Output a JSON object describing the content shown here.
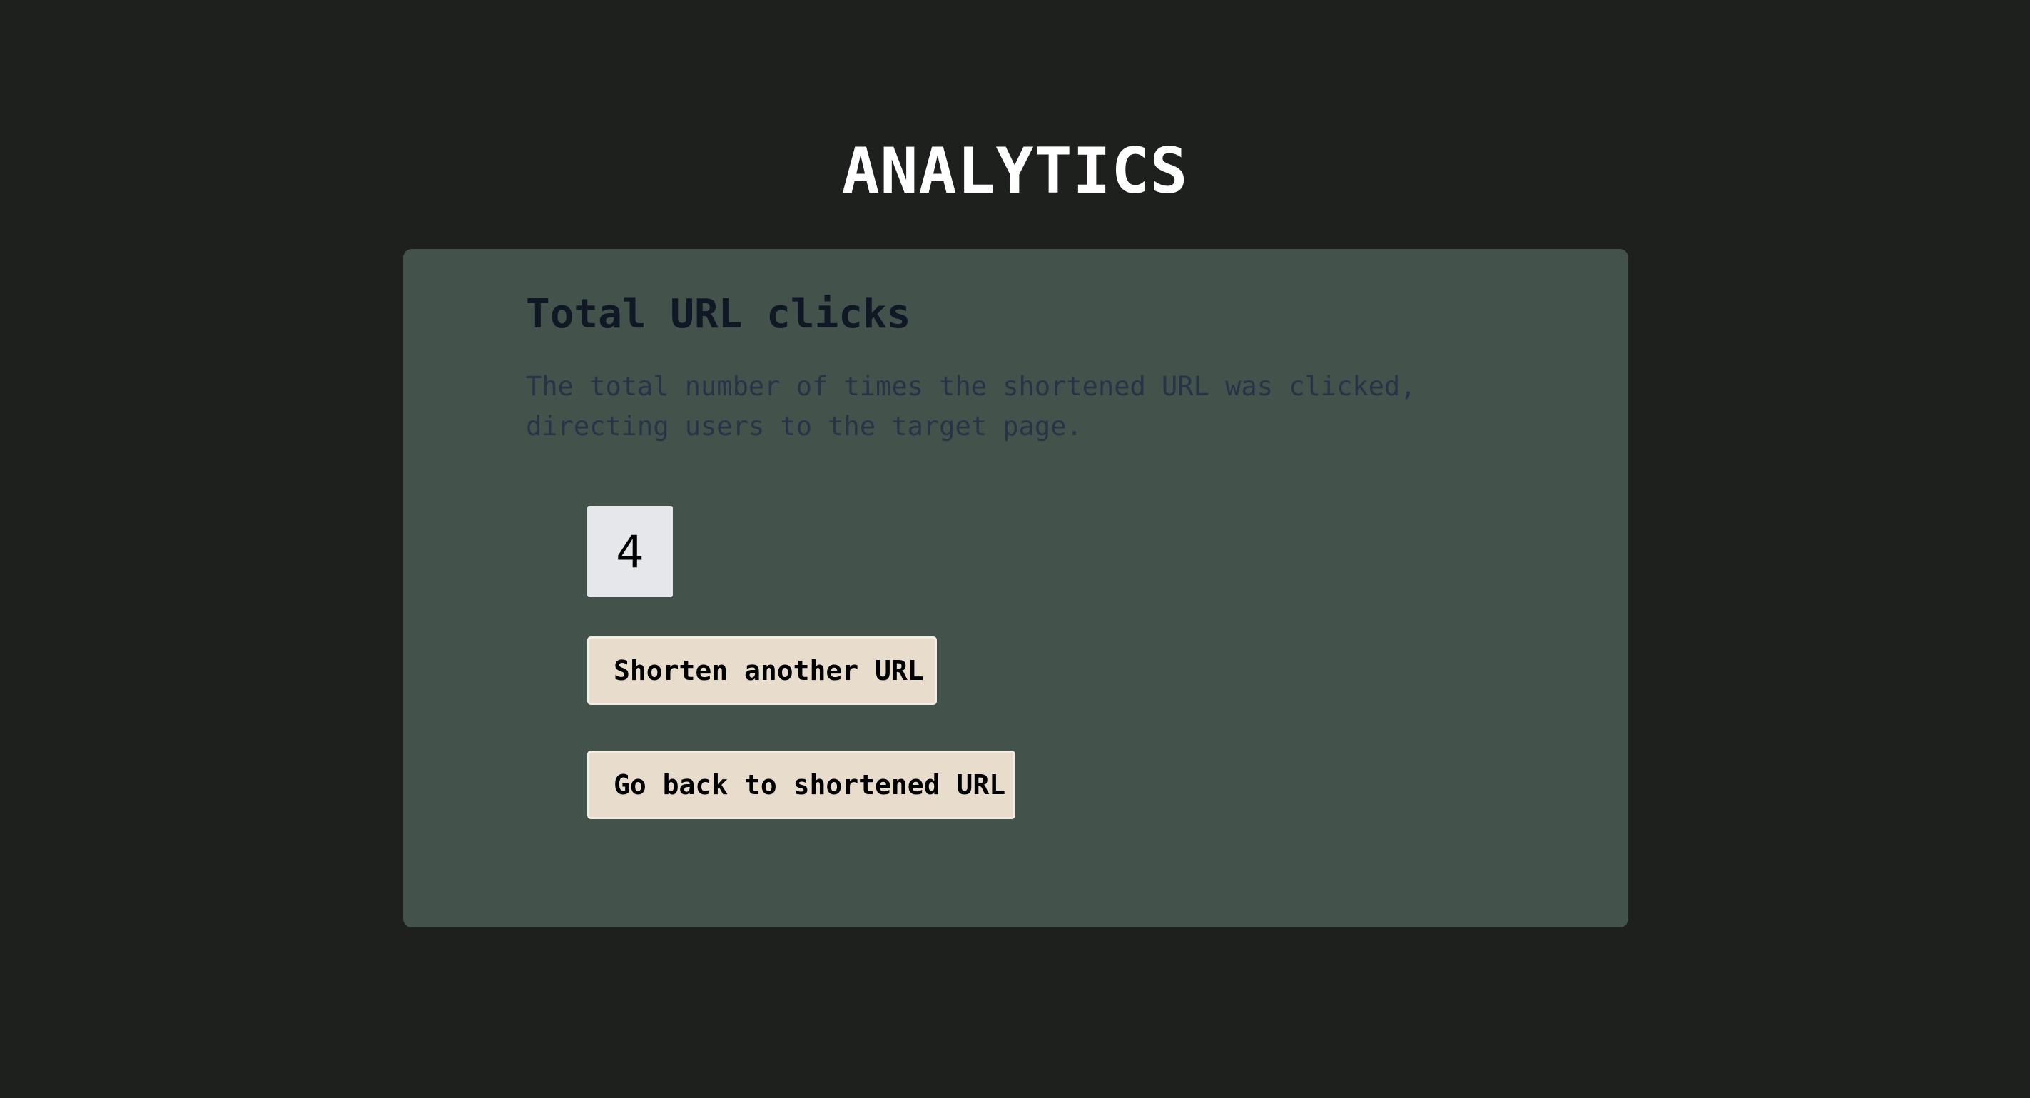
{
  "page": {
    "title": "ANALYTICS"
  },
  "card": {
    "heading": "Total URL clicks",
    "description": "The total number of times the shortened URL was clicked, directing users to the target page.",
    "click_count": "4"
  },
  "actions": {
    "shorten_another_label": "Shorten another URL",
    "go_back_label": "Go back to shortened URL"
  },
  "colors": {
    "background": "#1e201e",
    "card": "#43524b",
    "heading": "#101826",
    "description": "#273447",
    "count_box": "#e5e7eb",
    "button": "#e8dccc"
  }
}
